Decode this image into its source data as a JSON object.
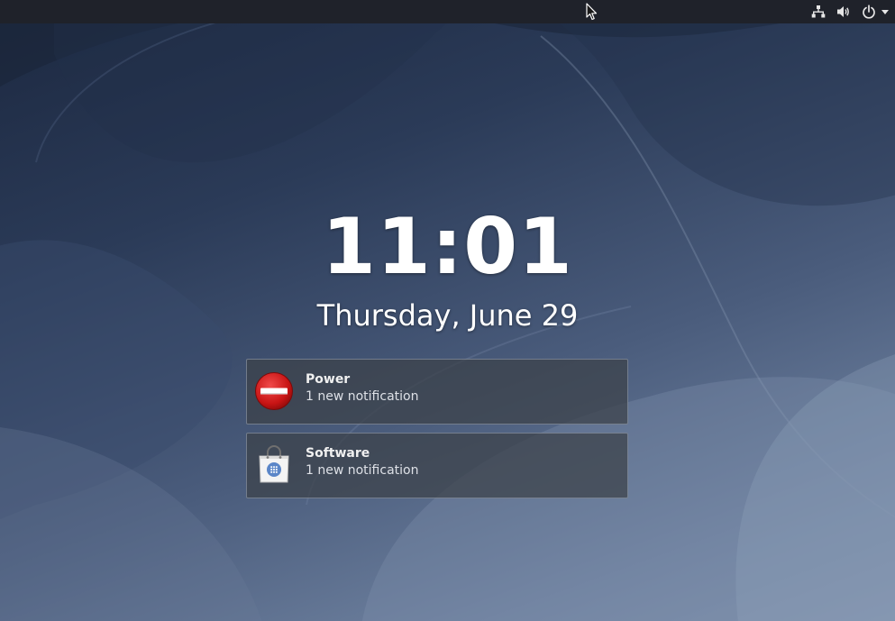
{
  "clock": {
    "time": "11:01",
    "date": "Thursday, June 29"
  },
  "top_bar": {
    "icons": [
      "network-wired-icon",
      "volume-icon",
      "power-icon",
      "menu-arrow-down-icon"
    ]
  },
  "notifications": [
    {
      "app": "Power",
      "summary": "1 new notification",
      "icon": "no-entry-icon"
    },
    {
      "app": "Software",
      "summary": "1 new notification",
      "icon": "software-bag-icon"
    }
  ],
  "colors": {
    "top_bar": "#1f222a",
    "notification_bg": "#3c4148",
    "text": "#ffffff",
    "power_icon_red": "#d81d1d"
  }
}
